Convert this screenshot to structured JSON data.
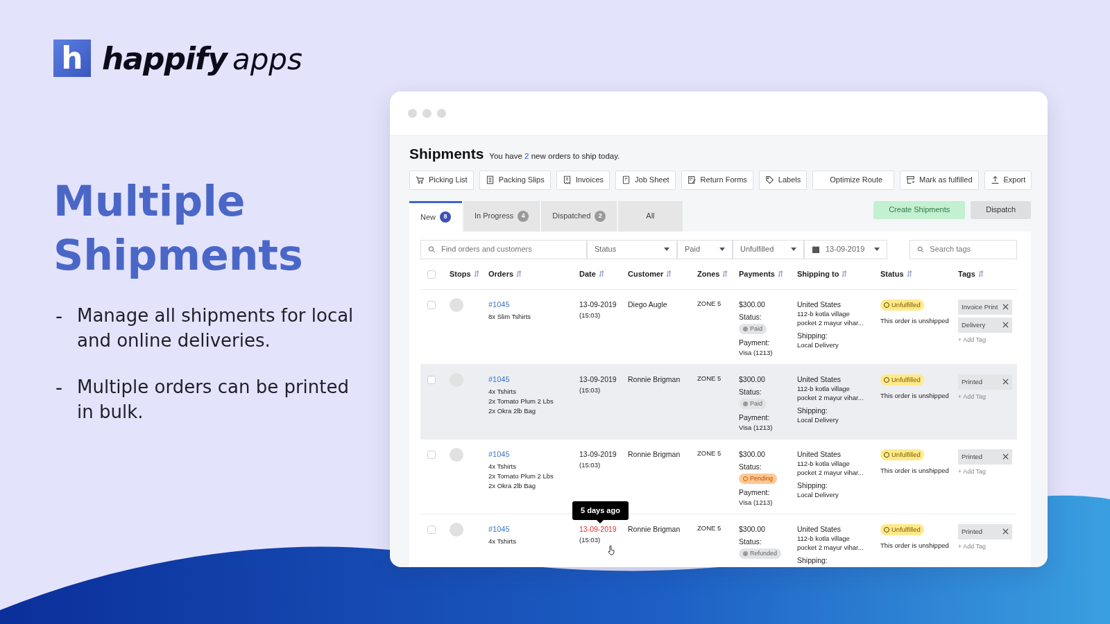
{
  "brand": {
    "logo_letter": "h",
    "name": "happify",
    "suffix": "apps"
  },
  "headline": "Multiple Shipments",
  "bullets": [
    {
      "dash": "-",
      "text": "Manage all shipments for local and online deliveries."
    },
    {
      "dash": "-",
      "text": "Multiple orders can be printed in bulk."
    }
  ],
  "app": {
    "title": "Shipments",
    "summary": {
      "before": "You have",
      "count": "2",
      "after": "new orders to ship today."
    },
    "toolbar": [
      {
        "label": "Picking List"
      },
      {
        "label": "Packing Slips"
      },
      {
        "label": "Invoices"
      },
      {
        "label": "Job Sheet"
      },
      {
        "label": "Return Forms"
      },
      {
        "label": "Labels"
      }
    ],
    "toolbar_right": [
      {
        "label": "Optimize Route"
      },
      {
        "label": "Mark as fulfilled"
      },
      {
        "label": "Export"
      }
    ],
    "tabs": [
      {
        "label": "New",
        "count": "8",
        "selected": true
      },
      {
        "label": "In Progress",
        "count": "4",
        "selected": false
      },
      {
        "label": "Dispatched",
        "count": "2",
        "selected": false
      },
      {
        "label": "All",
        "selected": false
      }
    ],
    "actions": [
      {
        "label": "Create Shipments",
        "disabled": true
      },
      {
        "label": "Dispatch",
        "disabled": false
      }
    ],
    "filters": [
      {
        "kind": "search",
        "placeholder": "Find orders and customers"
      },
      {
        "kind": "select",
        "value": "Status"
      },
      {
        "kind": "select",
        "value": "Paid"
      },
      {
        "kind": "select",
        "value": "Unfulfilled"
      },
      {
        "kind": "date",
        "value": "13-09-2019"
      },
      {
        "kind": "search",
        "placeholder": "Search tags"
      }
    ],
    "select_all": {
      "checked": false
    },
    "columns": [
      {
        "label": "Stops"
      },
      {
        "label": "Orders"
      },
      {
        "label": "Date"
      },
      {
        "label": "Customer"
      },
      {
        "label": "Zones"
      },
      {
        "label": "Payments"
      },
      {
        "label": "Shipping to"
      },
      {
        "label": "Status"
      },
      {
        "label": "Tags"
      }
    ],
    "rows": [
      {
        "checked": false,
        "highlighted": false,
        "order": "#1045",
        "items": [
          "8x Slim Tshirts"
        ],
        "date": "13-09-2019",
        "overdue": false,
        "time": "(15:03)",
        "customer": "Diego Augle",
        "zone": "ZONE 5",
        "amount": "$300.00",
        "status_label": "Status:",
        "payment_status": {
          "label": "Paid",
          "kind": "paid"
        },
        "payment_label": "Payment:",
        "card": "Visa (1213)",
        "country": "United States",
        "address": [
          "112-b kotla village",
          "pocket 2 mayur vihar..."
        ],
        "shipping_label": "Shipping:",
        "shipping_method": "Local Delivery",
        "fulfillment": "Unfulfilled",
        "note": "This order is unshipped",
        "tags": [
          "Invoice Print",
          "Delivery"
        ],
        "add_tag": "+ Add Tag"
      },
      {
        "checked": false,
        "highlighted": true,
        "order": "#1045",
        "items": [
          "4x Tshirts",
          "2x Tomato Plum 2 Lbs",
          "2x Okra 2lb Bag"
        ],
        "date": "13-09-2019",
        "overdue": false,
        "time": "(15:03)",
        "customer": "Ronnie Brigman",
        "zone": "ZONE 5",
        "amount": "$300.00",
        "status_label": "Status:",
        "payment_status": {
          "label": "Paid",
          "kind": "paid"
        },
        "payment_label": "Payment:",
        "card": "Visa (1213)",
        "country": "United States",
        "address": [
          "112-b kotla village",
          "pocket 2 mayur vihar..."
        ],
        "shipping_label": "Shipping:",
        "shipping_method": "Local Delivery",
        "fulfillment": "Unfulfilled",
        "note": "This order is unshipped",
        "tags": [
          "Printed"
        ],
        "add_tag": "+ Add Tag"
      },
      {
        "checked": false,
        "highlighted": false,
        "order": "#1045",
        "items": [
          "4x Tshirts",
          "2x Tomato Plum 2 Lbs",
          "2x Okra 2lb Bag"
        ],
        "date": "13-09-2019",
        "overdue": false,
        "time": "(15:03)",
        "customer": "Ronnie Brigman",
        "zone": "ZONE 5",
        "amount": "$300.00",
        "status_label": "Status:",
        "payment_status": {
          "label": "Pending",
          "kind": "pending"
        },
        "payment_label": "Payment:",
        "card": "Visa (1213)",
        "country": "United States",
        "address": [
          "112-b kotla village",
          "pocket 2 mayur vihar..."
        ],
        "shipping_label": "Shipping:",
        "shipping_method": "Local Delivery",
        "fulfillment": "Unfulfilled",
        "note": "This order is unshipped",
        "tags": [
          "Printed"
        ],
        "add_tag": "+ Add Tag"
      },
      {
        "checked": false,
        "highlighted": false,
        "order": "#1045",
        "items": [
          "4x Tshirts"
        ],
        "date": "13-09-2019",
        "overdue": true,
        "tooltip": "5 days ago",
        "time": "(15:03)",
        "customer": "Ronnie Brigman",
        "zone": "ZONE 5",
        "amount": "$300.00",
        "status_label": "Status:",
        "payment_status": {
          "label": "Refunded",
          "kind": "refunded"
        },
        "country": "United States",
        "address": [
          "112-b kotla village",
          "pocket 2 mayur vihar..."
        ],
        "shipping_label": "Shipping:",
        "fulfillment": "Unfulfilled",
        "note": "This order is unshipped",
        "tags": [
          "Printed"
        ],
        "add_tag": "+ Add Tag"
      }
    ]
  }
}
